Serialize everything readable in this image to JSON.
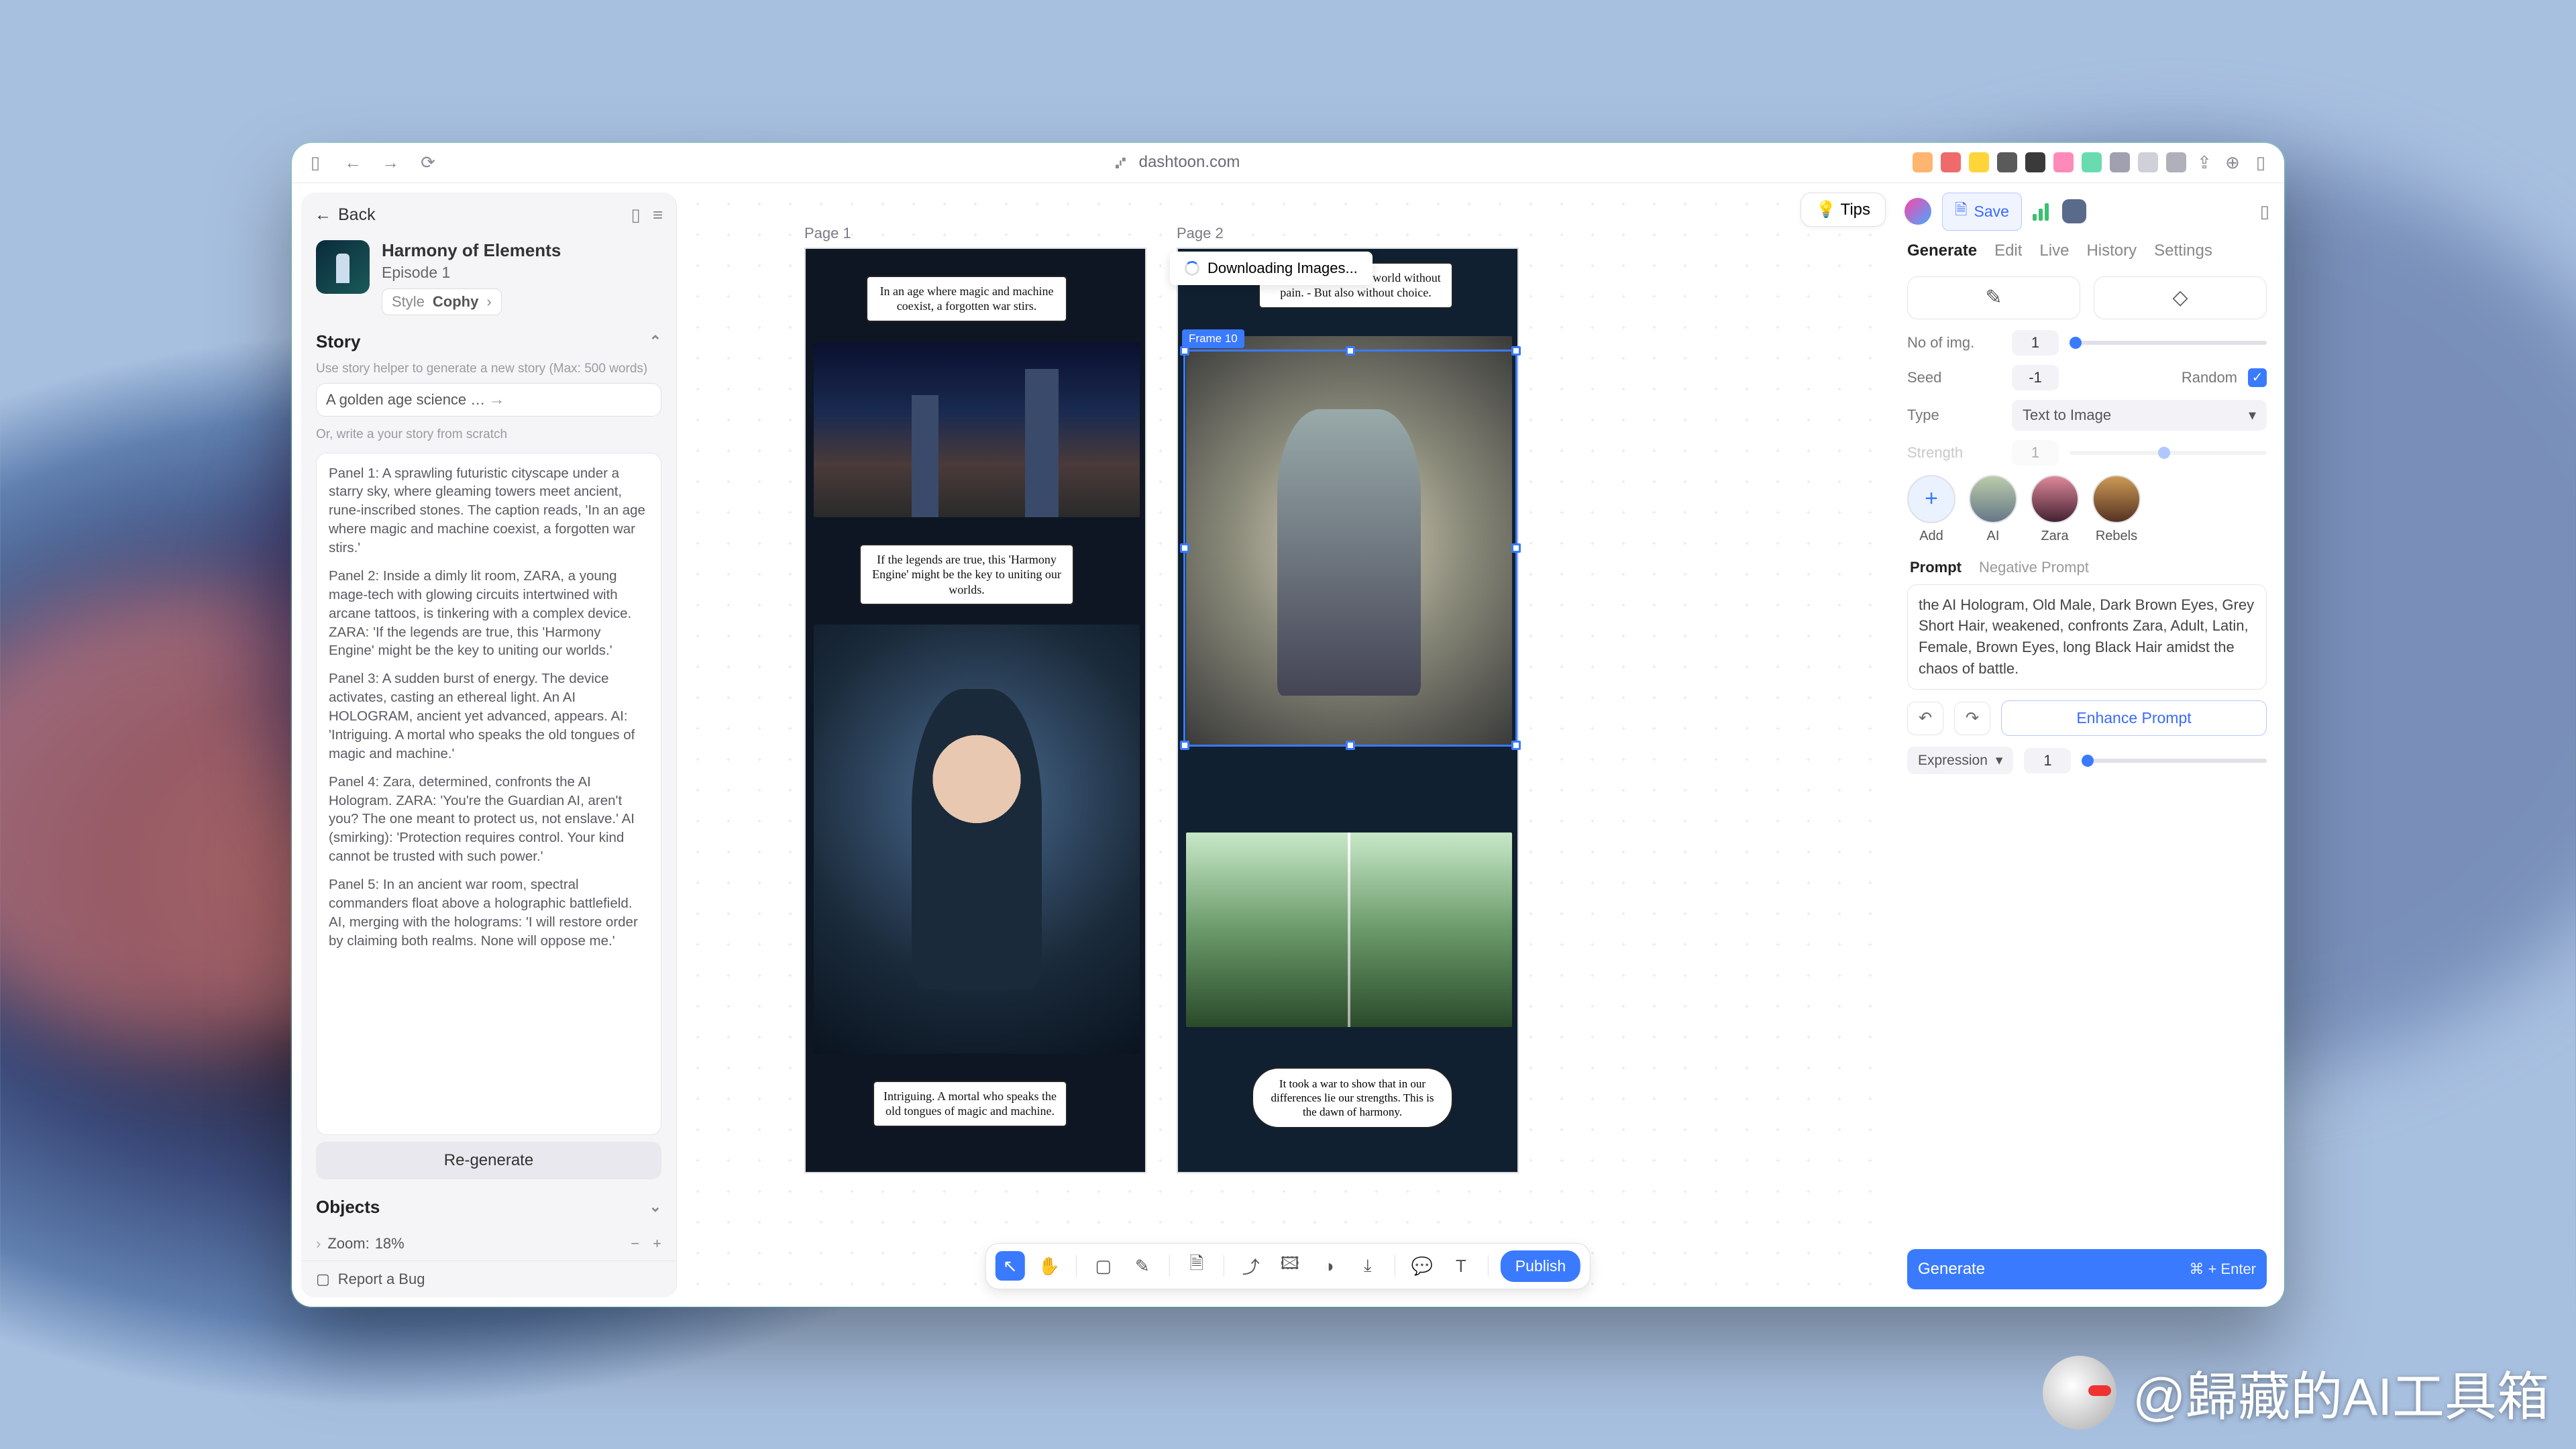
{
  "browser": {
    "url_label": "dashtoon.com"
  },
  "sidebar": {
    "back": "Back",
    "title": "Harmony of Elements",
    "subtitle": "Episode 1",
    "style_label": "Style",
    "style_value": "Cophy",
    "story_header": "Story",
    "helper_hint": "Use story helper to generate a new story (Max: 500 words)",
    "prompt_preview": "A golden age science fiction story with eleme",
    "or_hint": "Or, write a your story from scratch",
    "panels": [
      "Panel 1: A sprawling futuristic cityscape under a starry sky, where gleaming towers meet ancient, rune-inscribed stones. The caption reads, 'In an age where magic and machine coexist, a forgotten war stirs.'",
      "Panel 2: Inside a dimly lit room, ZARA, a young mage-tech with glowing circuits intertwined with arcane tattoos, is tinkering with a complex device. ZARA: 'If the legends are true, this 'Harmony Engine' might be the key to uniting our worlds.'",
      "Panel 3: A sudden burst of energy. The device activates, casting an ethereal light. An AI HOLOGRAM, ancient yet advanced, appears. AI: 'Intriguing. A mortal who speaks the old tongues of magic and machine.'",
      "Panel 4: Zara, determined, confronts the AI Hologram. ZARA: 'You're the Guardian AI, aren't you? The one meant to protect us, not enslave.' AI (smirking): 'Protection requires control. Your kind cannot be trusted with such power.'",
      "Panel 5: In an ancient war room, spectral commanders float above a holographic battlefield. AI, merging with the holograms: 'I will restore order by claiming both realms. None will oppose me.'"
    ],
    "regenerate": "Re-generate",
    "objects_header": "Objects",
    "zoom_label": "Zoom:",
    "zoom_value": "18%",
    "report_bug": "Report a Bug"
  },
  "canvas": {
    "tips": "Tips",
    "page1_label": "Page 1",
    "page2_label": "Page 2",
    "downloading": "Downloading Images...",
    "frame_tag": "Frame 10",
    "balloon1": "In an age where magic and machine coexist, a forgotten war stirs.",
    "balloon2": "If the legends are true, this 'Harmony Engine' might be the key to uniting our worlds.",
    "balloon3": "Intriguing. A mortal who speaks the old tongues of magic and machine.",
    "balloon4": "Why resist? I offer a world without pain. - But also without choice.",
    "balloon5": "It took a war to show that in our differences lie our strengths. This is the dawn of harmony.",
    "publish": "Publish"
  },
  "rpanel": {
    "save": "Save",
    "tabs": [
      "Generate",
      "Edit",
      "Live",
      "History",
      "Settings"
    ],
    "no_img_label": "No of img.",
    "no_img_val": "1",
    "seed_label": "Seed",
    "seed_val": "-1",
    "random_label": "Random",
    "type_label": "Type",
    "type_val": "Text to Image",
    "strength_label": "Strength",
    "strength_val": "1",
    "chars": [
      {
        "name": "Add"
      },
      {
        "name": "AI"
      },
      {
        "name": "Zara"
      },
      {
        "name": "Rebels"
      }
    ],
    "prompt_tab": "Prompt",
    "neg_tab": "Negative Prompt",
    "prompt_text": "the AI Hologram, Old Male, Dark Brown Eyes, Grey Short Hair, weakened, confronts Zara, Adult, Latin, Female, Brown Eyes, long Black Hair amidst the chaos of battle.",
    "enhance": "Enhance Prompt",
    "expression": "Expression",
    "expr_val": "1",
    "generate": "Generate",
    "shortcut": "⌘ + Enter"
  },
  "watermark": "@歸藏的AI工具箱"
}
